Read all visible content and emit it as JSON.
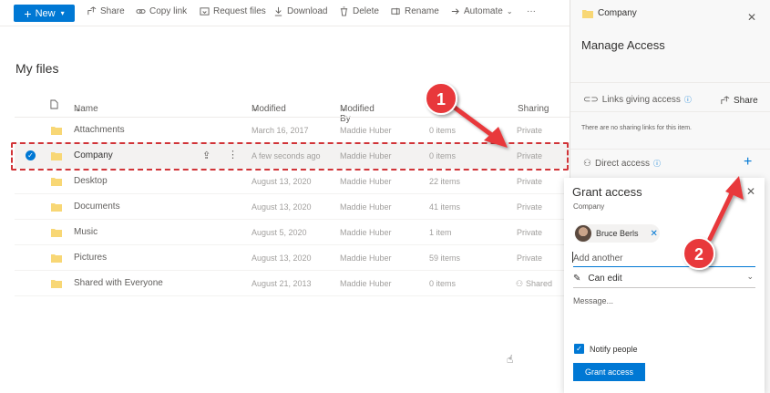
{
  "toolbar": {
    "new_label": "New",
    "share_label": "Share",
    "copy_link_label": "Copy link",
    "request_files_label": "Request files",
    "download_label": "Download",
    "delete_label": "Delete",
    "rename_label": "Rename",
    "automate_label": "Automate",
    "more_label": "···"
  },
  "page": {
    "title": "My files"
  },
  "table": {
    "headers": {
      "name": "Name",
      "modified": "Modified",
      "modified_by": "Modified By",
      "file_size": "",
      "sharing": "Sharing"
    },
    "rows": [
      {
        "name": "Attachments",
        "modified": "March 16, 2017",
        "modified_by": "Maddie Huber",
        "size": "0 items",
        "sharing": "Private",
        "selected": false
      },
      {
        "name": "Company",
        "modified": "A few seconds ago",
        "modified_by": "Maddie Huber",
        "size": "0 items",
        "sharing": "Private",
        "selected": true
      },
      {
        "name": "Desktop",
        "modified": "August 13, 2020",
        "modified_by": "Maddie Huber",
        "size": "22 items",
        "sharing": "Private",
        "selected": false
      },
      {
        "name": "Documents",
        "modified": "August 13, 2020",
        "modified_by": "Maddie Huber",
        "size": "41 items",
        "sharing": "Private",
        "selected": false
      },
      {
        "name": "Music",
        "modified": "August 5, 2020",
        "modified_by": "Maddie Huber",
        "size": "1 item",
        "sharing": "Private",
        "selected": false
      },
      {
        "name": "Pictures",
        "modified": "August 13, 2020",
        "modified_by": "Maddie Huber",
        "size": "59 items",
        "sharing": "Private",
        "selected": false
      },
      {
        "name": "Shared with Everyone",
        "modified": "August 21, 2013",
        "modified_by": "Maddie Huber",
        "size": "0 items",
        "sharing": "Shared",
        "selected": false
      }
    ]
  },
  "panel": {
    "folder_name": "Company",
    "title": "Manage Access",
    "links_label": "Links giving access",
    "share_label": "Share",
    "no_links_text": "There are no sharing links for this item.",
    "direct_access_label": "Direct access"
  },
  "grant": {
    "title": "Grant access",
    "subtitle": "Company",
    "person": "Bruce Berls",
    "add_placeholder": "Add another",
    "permission": "Can edit",
    "message_placeholder": "Message...",
    "notify_label": "Notify people",
    "button_label": "Grant access"
  },
  "annotations": {
    "badge1": "1",
    "badge2": "2"
  },
  "colors": {
    "accent": "#0078d4",
    "annotation_red": "#d13438",
    "folder": "#f8d775"
  },
  "icons": [
    "plus-icon",
    "share-icon",
    "link-icon",
    "request-files-icon",
    "download-icon",
    "delete-icon",
    "rename-icon",
    "automate-icon",
    "folder-icon",
    "close-icon",
    "info-icon",
    "person-icon",
    "pencil-icon",
    "checkmark-icon",
    "cursor-icon"
  ]
}
